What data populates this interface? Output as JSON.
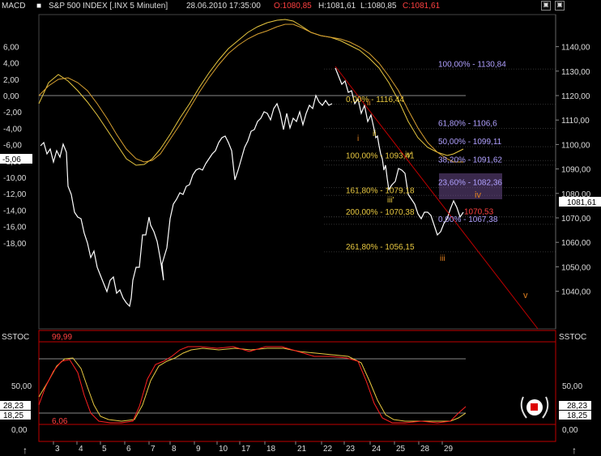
{
  "header": {
    "indicator": "MACD",
    "symbol": "S&P 500 INDEX [.INX  5 Minuten]",
    "datetime": "28.06.2010 17:35:00",
    "open": "O:1080,85",
    "high": "H:1081,61",
    "low": "L:1080,85",
    "close": "C:1081,61"
  },
  "lower_panel": {
    "label_left": "SSTOC",
    "label_right": "SSTOC",
    "upper_level": "99,99",
    "lower_level": "6,06",
    "value1": "28,23",
    "value2": "18,25"
  },
  "colors": {
    "price": "#ffffff",
    "ma_yellow": "#e8c840",
    "ma_orange": "#d8a030",
    "fib_label": "#e8c840",
    "fib_label2": "#b0a0ff",
    "wave": "#e08020",
    "panel_border": "#c00000",
    "trend_line": "#c00000"
  },
  "chart_data": [
    {
      "type": "line",
      "title": "S&P 500 INDEX [.INX  5 Minuten]",
      "x_ticks": [
        "3",
        "4",
        "5",
        "6",
        "7",
        "8",
        "9",
        "10",
        "17",
        "18",
        "21",
        "22",
        "23",
        "24",
        "25",
        "28",
        "29"
      ],
      "left_axis_ticks": [
        "6,00",
        "4,00",
        "2,00",
        "0,00",
        "-2,00",
        "-4,00",
        "-6,00",
        "-8,00",
        "-10,00",
        "-12,00",
        "-14,00",
        "-16,00",
        "-18,00"
      ],
      "right_axis_ticks": [
        "1140,00",
        "1130,00",
        "1120,00",
        "1110,00",
        "1100,00",
        "1090,00",
        "1080,00",
        "1070,00",
        "1060,00",
        "1050,00",
        "1040,00"
      ],
      "left_marker": "-5,06",
      "right_marker": "1081,61",
      "series": [
        {
          "name": "MACD",
          "x": [
            0,
            4,
            8,
            12,
            16,
            20,
            24,
            26,
            28,
            32,
            36,
            40,
            44,
            48,
            52,
            56,
            60,
            64,
            66,
            68,
            70,
            74,
            78,
            82,
            86,
            90
          ],
          "y": [
            -4,
            -5,
            -4.5,
            -6.5,
            -9,
            -11,
            -12.5,
            -13,
            -12,
            -15,
            -14,
            -16,
            -17,
            -16,
            -17,
            -14,
            -13,
            -11,
            -13,
            -12.5,
            -15,
            -11,
            -9,
            -7.5,
            -5,
            -2
          ]
        }
      ],
      "ylim_left": [
        -19,
        7
      ],
      "ylim_right": [
        1035,
        1150
      ]
    },
    {
      "type": "line",
      "title": "SSTOC",
      "y_ticks": [
        "50,00",
        "0,00"
      ],
      "levels": [
        "99,99",
        "6,06"
      ],
      "ylim": [
        0,
        100
      ]
    }
  ],
  "fib_levels": [
    {
      "label": "100,00% - 1130,84",
      "color": "#b0a0ff"
    },
    {
      "label": "0,00% - 1116,44",
      "color": "#e8c840"
    },
    {
      "label": "61,80% - 1106,6",
      "color": "#b0a0ff"
    },
    {
      "label": "50,00% - 1099,11",
      "color": "#b0a0ff"
    },
    {
      "label": "100,00% - 1093,41",
      "color": "#e8c840"
    },
    {
      "label": "38,20% - 1091,62",
      "color": "#b0a0ff"
    },
    {
      "label": "23,60% - 1082,36",
      "color": "#b0a0ff"
    },
    {
      "label": "161,80% - 1079,18",
      "color": "#e8c840"
    },
    {
      "label": "1070,53",
      "color": "#ff4040"
    },
    {
      "label": "200,00% - 1070,38",
      "color": "#e8c840"
    },
    {
      "label": "0,00% - 1067,38",
      "color": "#b0a0ff"
    },
    {
      "label": "261,80% - 1056,15",
      "color": "#e8c840"
    }
  ],
  "waves": [
    "i",
    "ii",
    "ii",
    "iii",
    "iii'",
    "iv'",
    "iv",
    "iii",
    "v",
    "ii'"
  ]
}
